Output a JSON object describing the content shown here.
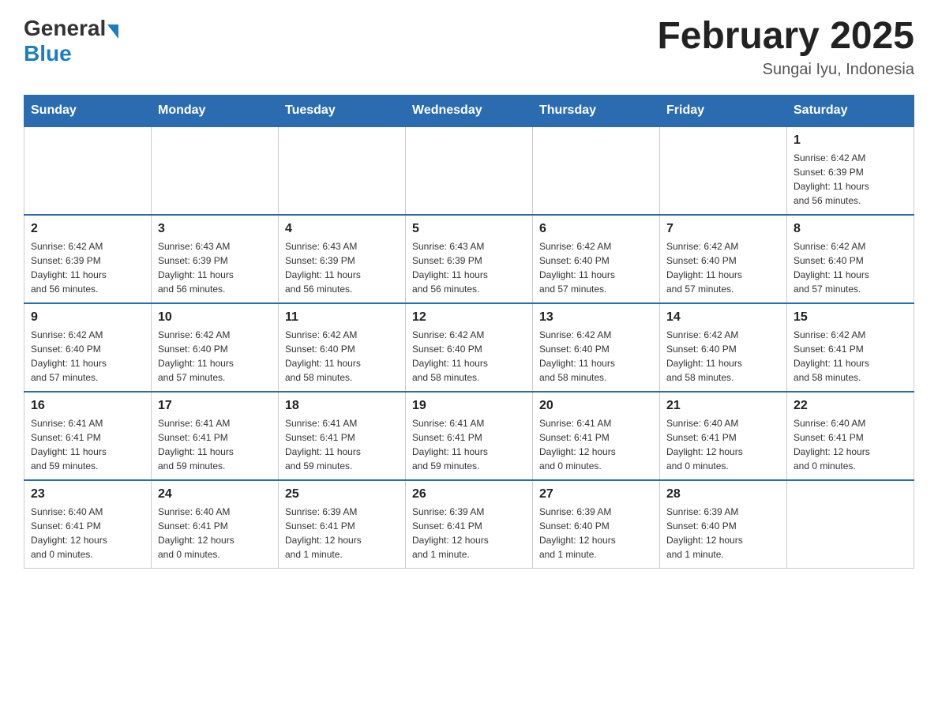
{
  "header": {
    "logo_general": "General",
    "logo_blue": "Blue",
    "month_year": "February 2025",
    "location": "Sungai Iyu, Indonesia"
  },
  "days_of_week": [
    "Sunday",
    "Monday",
    "Tuesday",
    "Wednesday",
    "Thursday",
    "Friday",
    "Saturday"
  ],
  "weeks": [
    [
      {
        "day": "",
        "info": ""
      },
      {
        "day": "",
        "info": ""
      },
      {
        "day": "",
        "info": ""
      },
      {
        "day": "",
        "info": ""
      },
      {
        "day": "",
        "info": ""
      },
      {
        "day": "",
        "info": ""
      },
      {
        "day": "1",
        "info": "Sunrise: 6:42 AM\nSunset: 6:39 PM\nDaylight: 11 hours\nand 56 minutes."
      }
    ],
    [
      {
        "day": "2",
        "info": "Sunrise: 6:42 AM\nSunset: 6:39 PM\nDaylight: 11 hours\nand 56 minutes."
      },
      {
        "day": "3",
        "info": "Sunrise: 6:43 AM\nSunset: 6:39 PM\nDaylight: 11 hours\nand 56 minutes."
      },
      {
        "day": "4",
        "info": "Sunrise: 6:43 AM\nSunset: 6:39 PM\nDaylight: 11 hours\nand 56 minutes."
      },
      {
        "day": "5",
        "info": "Sunrise: 6:43 AM\nSunset: 6:39 PM\nDaylight: 11 hours\nand 56 minutes."
      },
      {
        "day": "6",
        "info": "Sunrise: 6:42 AM\nSunset: 6:40 PM\nDaylight: 11 hours\nand 57 minutes."
      },
      {
        "day": "7",
        "info": "Sunrise: 6:42 AM\nSunset: 6:40 PM\nDaylight: 11 hours\nand 57 minutes."
      },
      {
        "day": "8",
        "info": "Sunrise: 6:42 AM\nSunset: 6:40 PM\nDaylight: 11 hours\nand 57 minutes."
      }
    ],
    [
      {
        "day": "9",
        "info": "Sunrise: 6:42 AM\nSunset: 6:40 PM\nDaylight: 11 hours\nand 57 minutes."
      },
      {
        "day": "10",
        "info": "Sunrise: 6:42 AM\nSunset: 6:40 PM\nDaylight: 11 hours\nand 57 minutes."
      },
      {
        "day": "11",
        "info": "Sunrise: 6:42 AM\nSunset: 6:40 PM\nDaylight: 11 hours\nand 58 minutes."
      },
      {
        "day": "12",
        "info": "Sunrise: 6:42 AM\nSunset: 6:40 PM\nDaylight: 11 hours\nand 58 minutes."
      },
      {
        "day": "13",
        "info": "Sunrise: 6:42 AM\nSunset: 6:40 PM\nDaylight: 11 hours\nand 58 minutes."
      },
      {
        "day": "14",
        "info": "Sunrise: 6:42 AM\nSunset: 6:40 PM\nDaylight: 11 hours\nand 58 minutes."
      },
      {
        "day": "15",
        "info": "Sunrise: 6:42 AM\nSunset: 6:41 PM\nDaylight: 11 hours\nand 58 minutes."
      }
    ],
    [
      {
        "day": "16",
        "info": "Sunrise: 6:41 AM\nSunset: 6:41 PM\nDaylight: 11 hours\nand 59 minutes."
      },
      {
        "day": "17",
        "info": "Sunrise: 6:41 AM\nSunset: 6:41 PM\nDaylight: 11 hours\nand 59 minutes."
      },
      {
        "day": "18",
        "info": "Sunrise: 6:41 AM\nSunset: 6:41 PM\nDaylight: 11 hours\nand 59 minutes."
      },
      {
        "day": "19",
        "info": "Sunrise: 6:41 AM\nSunset: 6:41 PM\nDaylight: 11 hours\nand 59 minutes."
      },
      {
        "day": "20",
        "info": "Sunrise: 6:41 AM\nSunset: 6:41 PM\nDaylight: 12 hours\nand 0 minutes."
      },
      {
        "day": "21",
        "info": "Sunrise: 6:40 AM\nSunset: 6:41 PM\nDaylight: 12 hours\nand 0 minutes."
      },
      {
        "day": "22",
        "info": "Sunrise: 6:40 AM\nSunset: 6:41 PM\nDaylight: 12 hours\nand 0 minutes."
      }
    ],
    [
      {
        "day": "23",
        "info": "Sunrise: 6:40 AM\nSunset: 6:41 PM\nDaylight: 12 hours\nand 0 minutes."
      },
      {
        "day": "24",
        "info": "Sunrise: 6:40 AM\nSunset: 6:41 PM\nDaylight: 12 hours\nand 0 minutes."
      },
      {
        "day": "25",
        "info": "Sunrise: 6:39 AM\nSunset: 6:41 PM\nDaylight: 12 hours\nand 1 minute."
      },
      {
        "day": "26",
        "info": "Sunrise: 6:39 AM\nSunset: 6:41 PM\nDaylight: 12 hours\nand 1 minute."
      },
      {
        "day": "27",
        "info": "Sunrise: 6:39 AM\nSunset: 6:40 PM\nDaylight: 12 hours\nand 1 minute."
      },
      {
        "day": "28",
        "info": "Sunrise: 6:39 AM\nSunset: 6:40 PM\nDaylight: 12 hours\nand 1 minute."
      },
      {
        "day": "",
        "info": ""
      }
    ]
  ]
}
